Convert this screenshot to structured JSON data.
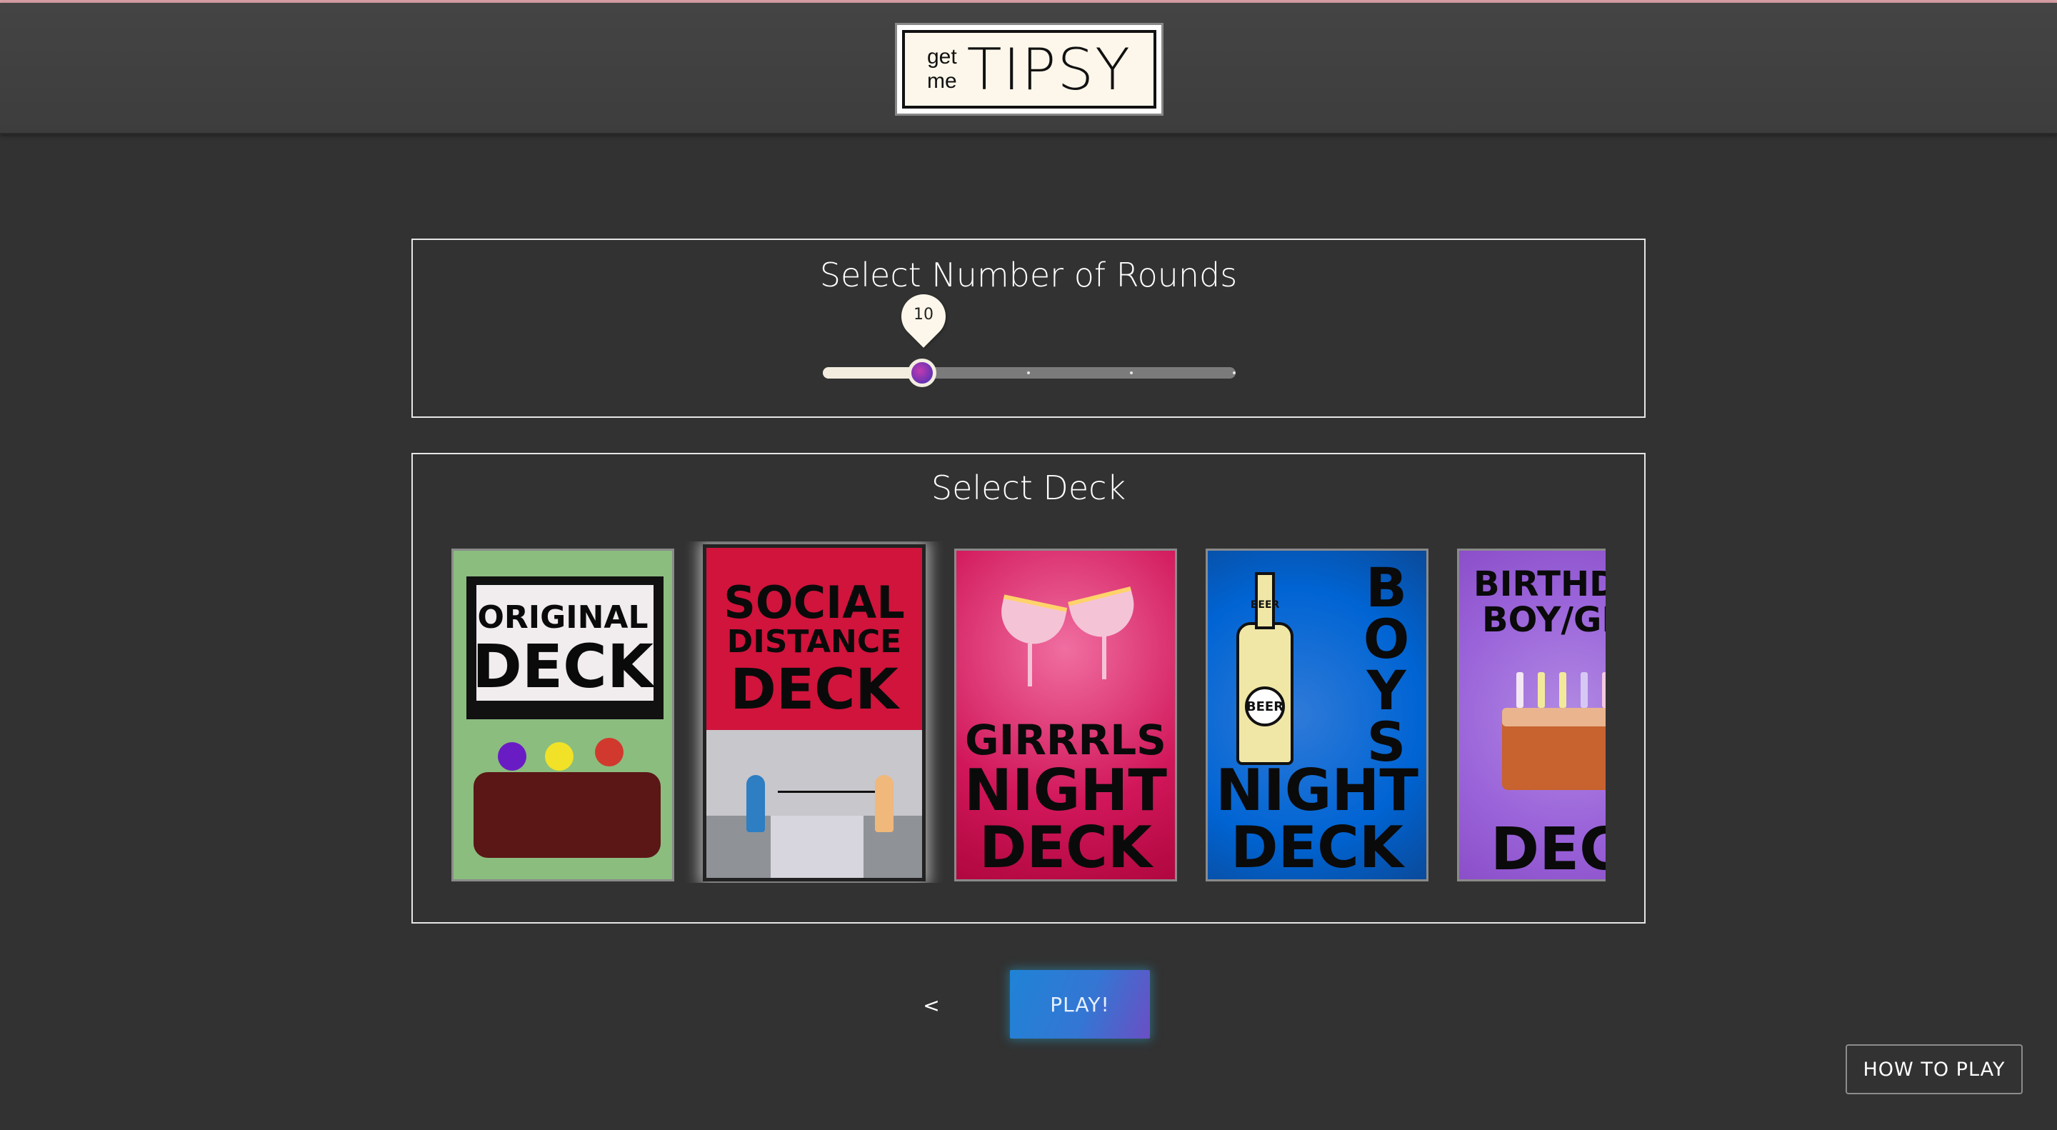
{
  "header": {
    "logo": {
      "small_top": "get",
      "small_bottom": "me",
      "big": "TIPSY"
    }
  },
  "rounds": {
    "title": "Select Number of Rounds",
    "value": 10
  },
  "deck_select": {
    "title": "Select Deck",
    "selected": "Social Distance Deck",
    "decks": [
      {
        "line1": "ORIGINAL",
        "line2": "DECK"
      },
      {
        "line1": "SOCIAL",
        "line2": "DISTANCE",
        "line3": "DECK"
      },
      {
        "line1": "GIRRRLS",
        "line2": "NIGHT",
        "line3": "DECK",
        "bottle_label": ""
      },
      {
        "line1": "BOYS",
        "line2": "NIGHT",
        "line3": "DECK",
        "bottle_top": "BEER",
        "bottle_label": "BEER"
      },
      {
        "line1": "BIRTHDA",
        "line2": "BOY/GI",
        "line3": "DECK"
      }
    ]
  },
  "controls": {
    "prev_label": "<",
    "play_label": "PLAY!",
    "how_to_play_label": "HOW TO PLAY"
  },
  "colors": {
    "background": "#323232",
    "header": "#444444",
    "accent_start": "#1f83d6",
    "accent_end": "#6a4fc4"
  }
}
